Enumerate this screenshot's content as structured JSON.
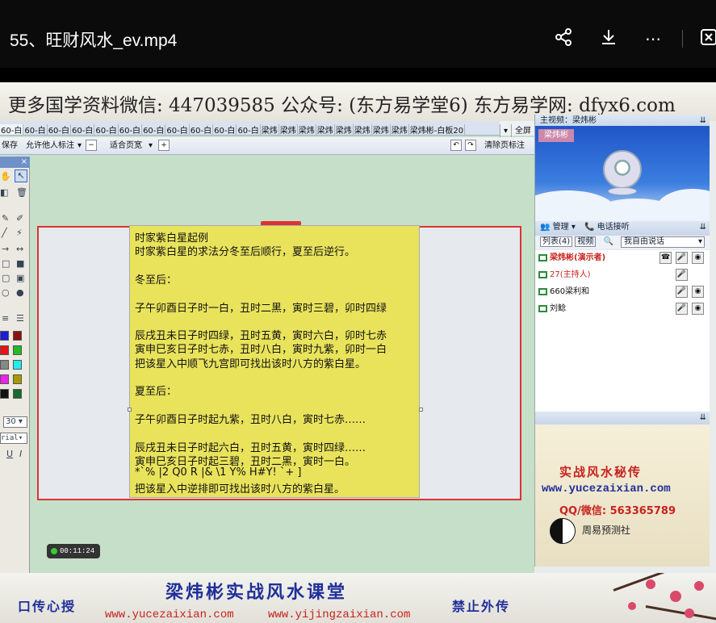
{
  "player": {
    "title": "55、旺财风水_ev.mp4",
    "icons": [
      "share-icon",
      "download-icon",
      "more-icon",
      "exit-icon"
    ]
  },
  "banner": {
    "text": "更多国学资料微信: 447039585 公众号: (东方易学堂6) 东方易学网: dfyx6.com"
  },
  "app": {
    "tabs": [
      "60-白",
      "60-白",
      "60-白",
      "60-白",
      "60-白",
      "60-白",
      "60-白",
      "60-白",
      "60-白",
      "60-白",
      "60-白",
      "梁炜",
      "梁炜",
      "梁炜",
      "梁炜",
      "梁炜",
      "梁炜",
      "梁炜",
      "梁炜",
      "梁炜彬-白板20"
    ],
    "fullscreen_label": "全屏",
    "toolbar": {
      "save": "保存",
      "allow_others": "允许他人标注",
      "fit_page": "适合页宽",
      "clear_annotations": "清除页标注"
    },
    "palette": {
      "font_size": "30",
      "font_name": "rial",
      "underline": "U",
      "italic": "I"
    },
    "document_lines": [
      "时家紫白星起例",
      "时家紫白星的求法分冬至后顺行，夏至后逆行。",
      "",
      "冬至后：",
      "",
      "子午卯酉日子时一白，丑时二黑，寅时三碧，卯时四绿",
      "",
      "辰戌丑未日子时四绿，丑时五黄，寅时六白，卯时七赤",
      "寅申巳亥日子时七赤，丑时八白，寅时九紫，卯时一白",
      "把该星入中顺飞九宫即可找出该时八方的紫白星。",
      "",
      "夏至后：",
      "",
      "子午卯酉日子时起九紫，丑时八白，寅时七赤……",
      "",
      "辰戌丑未日子时起六白，丑时五黄，寅时四绿……",
      "寅申巳亥日子时起三碧，丑时二黑，寅时一白。",
      "*`% |2 Q0 R |& \\1 Y% H#Y! `+ ]",
      "把该星入中逆排即可找出该时八方的紫白星。"
    ],
    "timer": "00:11:24"
  },
  "rpanel": {
    "video_header": "主视频：梁炜彬",
    "cam_badge": "梁炜彬",
    "manage": "管理",
    "phone": "电话接听",
    "tab_list": "列表(4)",
    "tab_video": "视频",
    "speak_mode": "我自由说话",
    "users": [
      {
        "name": "梁炜彬(演示者)",
        "color": "#c8221e",
        "bold": true
      },
      {
        "name": "27(主持人)",
        "color": "#c8221e",
        "bold": false
      },
      {
        "name": "660梁利和",
        "color": "#111111",
        "bold": false
      },
      {
        "name": "刘鲶",
        "color": "#111111",
        "bold": false
      }
    ]
  },
  "ad": {
    "title": "实战风水秘传",
    "url": "www.yucezaixian.com",
    "contact": "QQ/微信: 563365789",
    "org": "周易预测社"
  },
  "footer": {
    "title": "梁炜彬实战风水课堂",
    "left": "口传心授",
    "right": "禁止外传",
    "url1": "www.yucezaixian.com",
    "url2": "www.yijingzaixian.com"
  }
}
